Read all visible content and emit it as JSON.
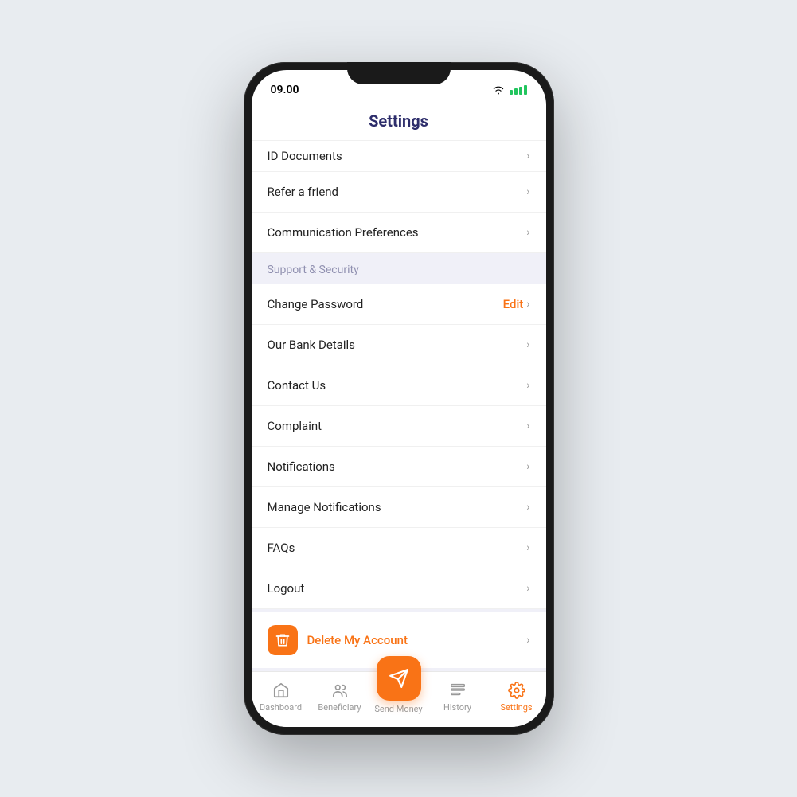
{
  "statusBar": {
    "time": "09.00",
    "wifi": "wifi-icon",
    "battery": "battery-icon"
  },
  "header": {
    "title": "Settings"
  },
  "menu": {
    "partialItem": {
      "label": "ID Documents"
    },
    "items1": [
      {
        "id": "refer-friend",
        "label": "Refer a friend"
      },
      {
        "id": "communication-preferences",
        "label": "Communication Preferences"
      }
    ],
    "section1": {
      "label": "Support & Security"
    },
    "items2": [
      {
        "id": "change-password",
        "label": "Change Password",
        "hasEdit": true,
        "editLabel": "Edit"
      },
      {
        "id": "our-bank-details",
        "label": "Our Bank Details"
      },
      {
        "id": "contact-us",
        "label": "Contact Us"
      },
      {
        "id": "complaint",
        "label": "Complaint"
      },
      {
        "id": "notifications",
        "label": "Notifications"
      },
      {
        "id": "manage-notifications",
        "label": "Manage Notifications"
      },
      {
        "id": "faqs",
        "label": "FAQs"
      },
      {
        "id": "logout",
        "label": "Logout"
      }
    ],
    "deleteAccount": {
      "label": "Delete My Account"
    }
  },
  "bottomNav": {
    "items": [
      {
        "id": "dashboard",
        "label": "Dashboard",
        "icon": "home-icon",
        "active": false
      },
      {
        "id": "beneficiary",
        "label": "Beneficiary",
        "icon": "users-icon",
        "active": false
      },
      {
        "id": "send-money",
        "label": "Send Money",
        "icon": "send-icon",
        "active": false,
        "isFab": true
      },
      {
        "id": "history",
        "label": "History",
        "icon": "history-icon",
        "active": false
      },
      {
        "id": "settings",
        "label": "Settings",
        "icon": "settings-icon",
        "active": true
      }
    ]
  },
  "colors": {
    "accent": "#f97316",
    "brand": "#2d2d6b",
    "sectionBg": "#f0f0f8",
    "sectionText": "#9090b0"
  }
}
